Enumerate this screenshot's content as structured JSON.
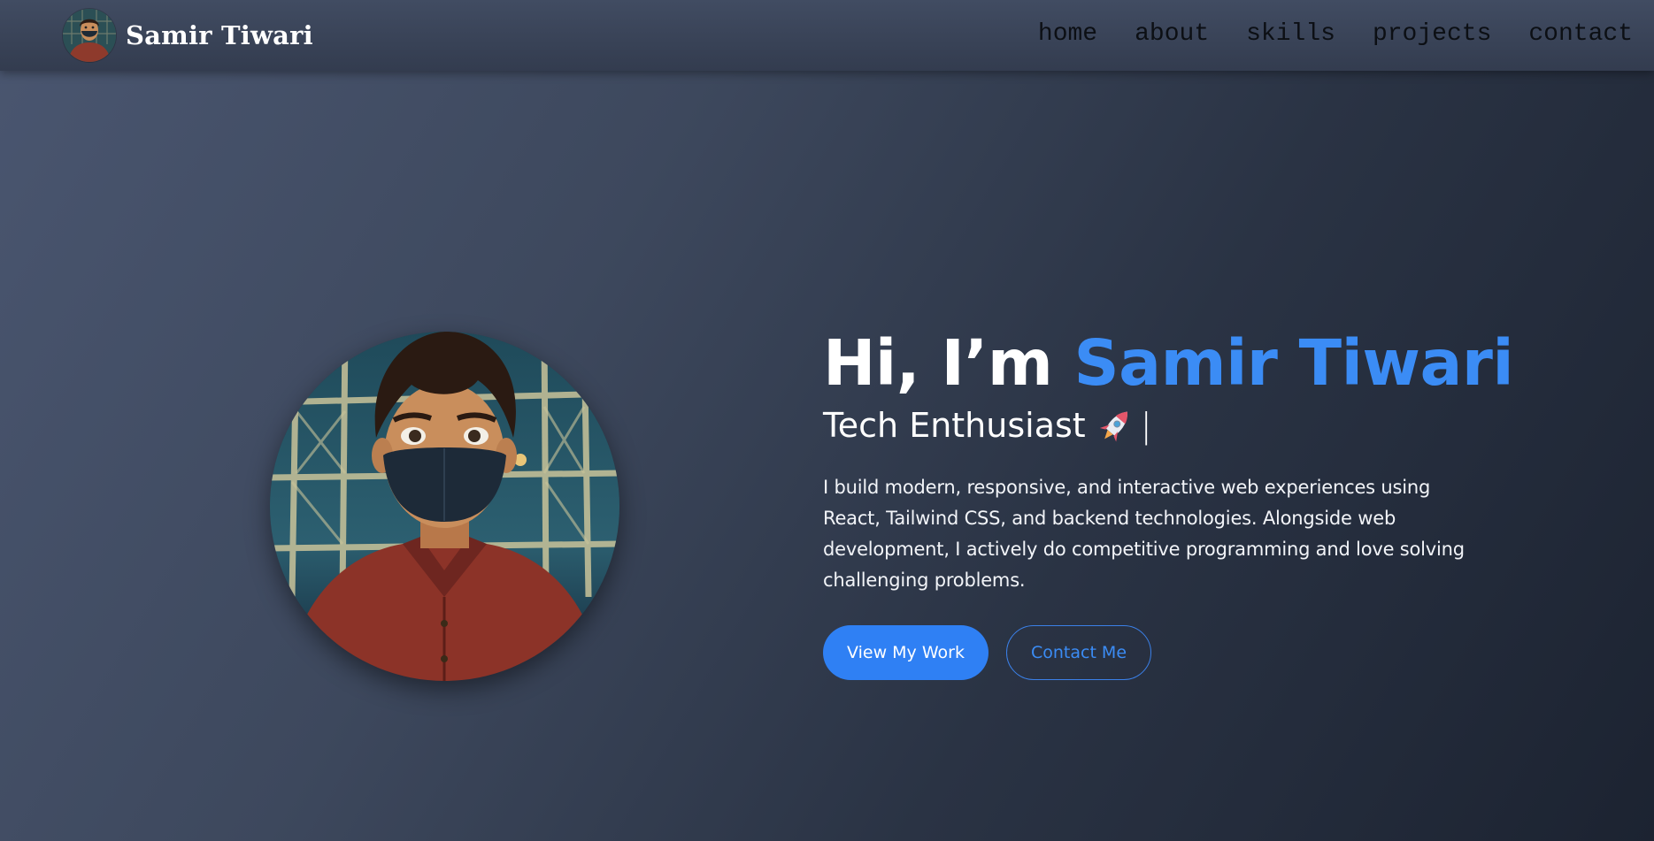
{
  "header": {
    "brand_name": "Samir Tiwari",
    "brand_avatar_icon": "profile-avatar",
    "nav": [
      {
        "label": "home"
      },
      {
        "label": "about"
      },
      {
        "label": "skills"
      },
      {
        "label": "projects"
      },
      {
        "label": "contact"
      }
    ]
  },
  "hero": {
    "greeting": "Hi, I’m ",
    "name": "Samir Tiwari",
    "tagline": "Tech Enthusiast",
    "tagline_icon": "rocket-icon",
    "cursor": "|",
    "intro": "I build modern, responsive, and interactive web experiences using React, Tailwind CSS, and backend technologies. Alongside web development, I actively do competitive programming and love solving challenging problems.",
    "primary_button": "View My Work",
    "secondary_button": "Contact Me",
    "portrait_icon": "anime-portrait"
  },
  "colors": {
    "accent": "#3b8cf5",
    "primary_button_bg": "#2f80f4",
    "header_bg": "#3a4458",
    "page_bg_dark": "#1c2331",
    "nav_text": "#0c0f14"
  }
}
